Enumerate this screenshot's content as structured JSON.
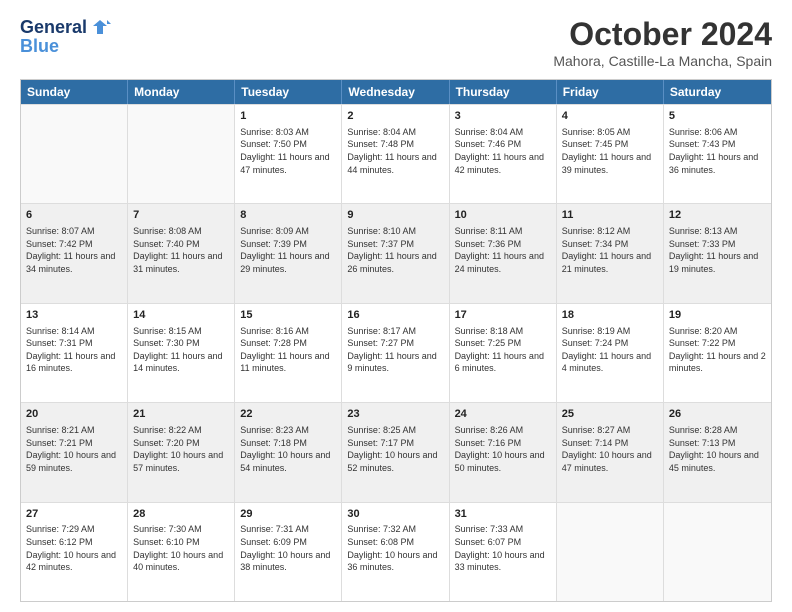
{
  "header": {
    "logo_line1": "General",
    "logo_line2": "Blue",
    "month": "October 2024",
    "location": "Mahora, Castille-La Mancha, Spain"
  },
  "weekdays": [
    "Sunday",
    "Monday",
    "Tuesday",
    "Wednesday",
    "Thursday",
    "Friday",
    "Saturday"
  ],
  "rows": [
    [
      {
        "day": "",
        "sunrise": "",
        "sunset": "",
        "daylight": "",
        "empty": true
      },
      {
        "day": "",
        "sunrise": "",
        "sunset": "",
        "daylight": "",
        "empty": true
      },
      {
        "day": "1",
        "sunrise": "Sunrise: 8:03 AM",
        "sunset": "Sunset: 7:50 PM",
        "daylight": "Daylight: 11 hours and 47 minutes."
      },
      {
        "day": "2",
        "sunrise": "Sunrise: 8:04 AM",
        "sunset": "Sunset: 7:48 PM",
        "daylight": "Daylight: 11 hours and 44 minutes."
      },
      {
        "day": "3",
        "sunrise": "Sunrise: 8:04 AM",
        "sunset": "Sunset: 7:46 PM",
        "daylight": "Daylight: 11 hours and 42 minutes."
      },
      {
        "day": "4",
        "sunrise": "Sunrise: 8:05 AM",
        "sunset": "Sunset: 7:45 PM",
        "daylight": "Daylight: 11 hours and 39 minutes."
      },
      {
        "day": "5",
        "sunrise": "Sunrise: 8:06 AM",
        "sunset": "Sunset: 7:43 PM",
        "daylight": "Daylight: 11 hours and 36 minutes."
      }
    ],
    [
      {
        "day": "6",
        "sunrise": "Sunrise: 8:07 AM",
        "sunset": "Sunset: 7:42 PM",
        "daylight": "Daylight: 11 hours and 34 minutes."
      },
      {
        "day": "7",
        "sunrise": "Sunrise: 8:08 AM",
        "sunset": "Sunset: 7:40 PM",
        "daylight": "Daylight: 11 hours and 31 minutes."
      },
      {
        "day": "8",
        "sunrise": "Sunrise: 8:09 AM",
        "sunset": "Sunset: 7:39 PM",
        "daylight": "Daylight: 11 hours and 29 minutes."
      },
      {
        "day": "9",
        "sunrise": "Sunrise: 8:10 AM",
        "sunset": "Sunset: 7:37 PM",
        "daylight": "Daylight: 11 hours and 26 minutes."
      },
      {
        "day": "10",
        "sunrise": "Sunrise: 8:11 AM",
        "sunset": "Sunset: 7:36 PM",
        "daylight": "Daylight: 11 hours and 24 minutes."
      },
      {
        "day": "11",
        "sunrise": "Sunrise: 8:12 AM",
        "sunset": "Sunset: 7:34 PM",
        "daylight": "Daylight: 11 hours and 21 minutes."
      },
      {
        "day": "12",
        "sunrise": "Sunrise: 8:13 AM",
        "sunset": "Sunset: 7:33 PM",
        "daylight": "Daylight: 11 hours and 19 minutes."
      }
    ],
    [
      {
        "day": "13",
        "sunrise": "Sunrise: 8:14 AM",
        "sunset": "Sunset: 7:31 PM",
        "daylight": "Daylight: 11 hours and 16 minutes."
      },
      {
        "day": "14",
        "sunrise": "Sunrise: 8:15 AM",
        "sunset": "Sunset: 7:30 PM",
        "daylight": "Daylight: 11 hours and 14 minutes."
      },
      {
        "day": "15",
        "sunrise": "Sunrise: 8:16 AM",
        "sunset": "Sunset: 7:28 PM",
        "daylight": "Daylight: 11 hours and 11 minutes."
      },
      {
        "day": "16",
        "sunrise": "Sunrise: 8:17 AM",
        "sunset": "Sunset: 7:27 PM",
        "daylight": "Daylight: 11 hours and 9 minutes."
      },
      {
        "day": "17",
        "sunrise": "Sunrise: 8:18 AM",
        "sunset": "Sunset: 7:25 PM",
        "daylight": "Daylight: 11 hours and 6 minutes."
      },
      {
        "day": "18",
        "sunrise": "Sunrise: 8:19 AM",
        "sunset": "Sunset: 7:24 PM",
        "daylight": "Daylight: 11 hours and 4 minutes."
      },
      {
        "day": "19",
        "sunrise": "Sunrise: 8:20 AM",
        "sunset": "Sunset: 7:22 PM",
        "daylight": "Daylight: 11 hours and 2 minutes."
      }
    ],
    [
      {
        "day": "20",
        "sunrise": "Sunrise: 8:21 AM",
        "sunset": "Sunset: 7:21 PM",
        "daylight": "Daylight: 10 hours and 59 minutes."
      },
      {
        "day": "21",
        "sunrise": "Sunrise: 8:22 AM",
        "sunset": "Sunset: 7:20 PM",
        "daylight": "Daylight: 10 hours and 57 minutes."
      },
      {
        "day": "22",
        "sunrise": "Sunrise: 8:23 AM",
        "sunset": "Sunset: 7:18 PM",
        "daylight": "Daylight: 10 hours and 54 minutes."
      },
      {
        "day": "23",
        "sunrise": "Sunrise: 8:25 AM",
        "sunset": "Sunset: 7:17 PM",
        "daylight": "Daylight: 10 hours and 52 minutes."
      },
      {
        "day": "24",
        "sunrise": "Sunrise: 8:26 AM",
        "sunset": "Sunset: 7:16 PM",
        "daylight": "Daylight: 10 hours and 50 minutes."
      },
      {
        "day": "25",
        "sunrise": "Sunrise: 8:27 AM",
        "sunset": "Sunset: 7:14 PM",
        "daylight": "Daylight: 10 hours and 47 minutes."
      },
      {
        "day": "26",
        "sunrise": "Sunrise: 8:28 AM",
        "sunset": "Sunset: 7:13 PM",
        "daylight": "Daylight: 10 hours and 45 minutes."
      }
    ],
    [
      {
        "day": "27",
        "sunrise": "Sunrise: 7:29 AM",
        "sunset": "Sunset: 6:12 PM",
        "daylight": "Daylight: 10 hours and 42 minutes."
      },
      {
        "day": "28",
        "sunrise": "Sunrise: 7:30 AM",
        "sunset": "Sunset: 6:10 PM",
        "daylight": "Daylight: 10 hours and 40 minutes."
      },
      {
        "day": "29",
        "sunrise": "Sunrise: 7:31 AM",
        "sunset": "Sunset: 6:09 PM",
        "daylight": "Daylight: 10 hours and 38 minutes."
      },
      {
        "day": "30",
        "sunrise": "Sunrise: 7:32 AM",
        "sunset": "Sunset: 6:08 PM",
        "daylight": "Daylight: 10 hours and 36 minutes."
      },
      {
        "day": "31",
        "sunrise": "Sunrise: 7:33 AM",
        "sunset": "Sunset: 6:07 PM",
        "daylight": "Daylight: 10 hours and 33 minutes."
      },
      {
        "day": "",
        "sunrise": "",
        "sunset": "",
        "daylight": "",
        "empty": true
      },
      {
        "day": "",
        "sunrise": "",
        "sunset": "",
        "daylight": "",
        "empty": true
      }
    ]
  ]
}
